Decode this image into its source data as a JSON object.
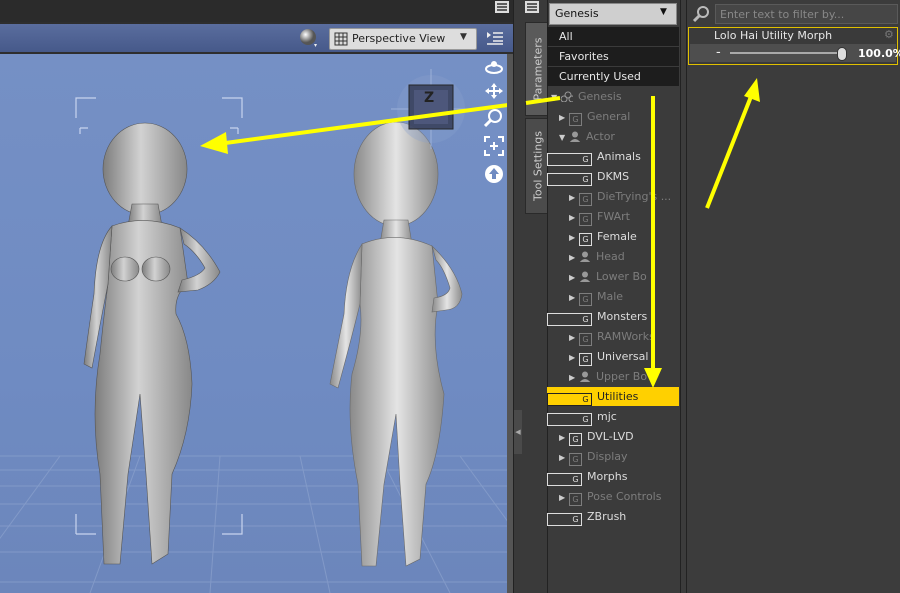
{
  "viewport": {
    "view_mode": "Perspective View",
    "nav_icons": [
      "orbit-icon",
      "pan-icon",
      "zoom-icon",
      "frame-icon",
      "reset-icon"
    ],
    "cube_label": "Z"
  },
  "side_tabs": [
    "Parameters",
    "Tool Settings"
  ],
  "tree": {
    "selector": "Genesis",
    "top_items": [
      "All",
      "Favorites",
      "Currently Used"
    ],
    "items": [
      {
        "label": "Genesis"
      },
      {
        "label": "General"
      },
      {
        "label": "Actor"
      },
      {
        "label": "Animals"
      },
      {
        "label": "DKMS"
      },
      {
        "label": "DieTrying's ..."
      },
      {
        "label": "FWArt"
      },
      {
        "label": "Female"
      },
      {
        "label": "Head"
      },
      {
        "label": "Lower Bo"
      },
      {
        "label": "Male"
      },
      {
        "label": "Monsters"
      },
      {
        "label": "RAMWorks"
      },
      {
        "label": "Universal"
      },
      {
        "label": "Upper Bo"
      },
      {
        "label": "Utilities"
      },
      {
        "label": "mjc"
      },
      {
        "label": "DVL-LVD"
      },
      {
        "label": "Display"
      },
      {
        "label": "Morphs"
      },
      {
        "label": "Pose Controls"
      },
      {
        "label": "ZBrush"
      }
    ]
  },
  "parameters": {
    "filter_placeholder": "Enter text to filter by...",
    "morph_name": "Lolo Hai Utility Morph",
    "slider_value": "100.0%",
    "slider_fraction": 1.0
  },
  "colors": {
    "highlight": "#ffd000",
    "arrow": "#ffff00",
    "viewport_bg": "#7590c5"
  }
}
